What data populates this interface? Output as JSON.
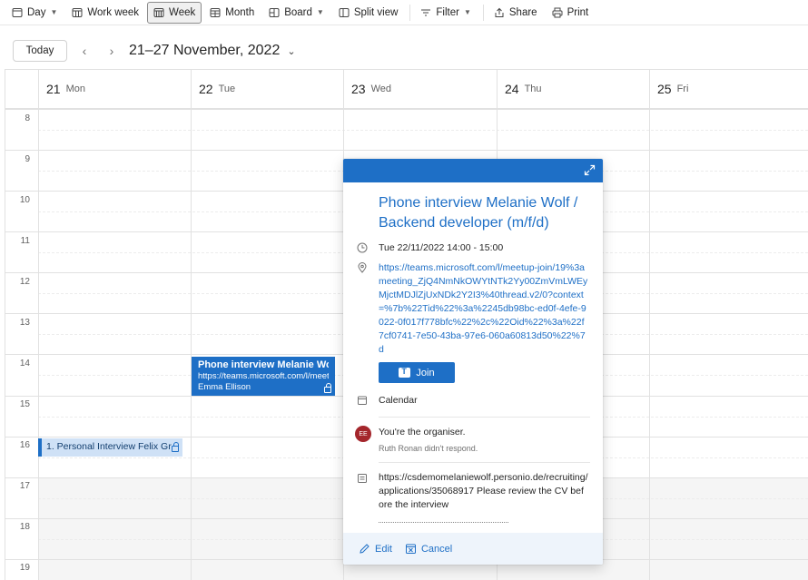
{
  "toolbar": {
    "items": [
      {
        "label": "Day",
        "icon": "day-view-icon",
        "dropdown": true
      },
      {
        "label": "Work week",
        "icon": "work-week-icon"
      },
      {
        "label": "Week",
        "icon": "week-icon",
        "active": true
      },
      {
        "label": "Month",
        "icon": "month-icon"
      },
      {
        "label": "Board",
        "icon": "board-icon",
        "dropdown": true
      },
      {
        "label": "Split view",
        "icon": "split-view-icon"
      },
      {
        "label": "Filter",
        "icon": "filter-icon",
        "dropdown": true
      },
      {
        "label": "Share",
        "icon": "share-icon"
      },
      {
        "label": "Print",
        "icon": "print-icon"
      }
    ]
  },
  "nav": {
    "today_label": "Today",
    "prev_icon": "chevron-left-icon",
    "next_icon": "chevron-right-icon",
    "range_title": "21–27 November, 2022"
  },
  "days": [
    {
      "num": "21",
      "name": "Mon"
    },
    {
      "num": "22",
      "name": "Tue"
    },
    {
      "num": "23",
      "name": "Wed"
    },
    {
      "num": "24",
      "name": "Thu"
    },
    {
      "num": "25",
      "name": "Fri"
    }
  ],
  "hours": [
    "8",
    "9",
    "10",
    "11",
    "12",
    "13",
    "14",
    "15",
    "16",
    "17",
    "18",
    "19"
  ],
  "events": {
    "main": {
      "title": "Phone interview Melanie Wolf",
      "link": "https://teams.microsoft.com/l/meetup",
      "person": "Emma Ellison"
    },
    "small": {
      "title": "1. Personal Interview Felix Gr"
    }
  },
  "popup": {
    "title": "Phone interview Melanie Wolf / Backend developer (m/f/d)",
    "datetime": "Tue 22/11/2022 14:00 - 15:00",
    "location_link": "https://teams.microsoft.com/l/meetup-join/19%3ameeting_ZjQ4NmNkOWYtNTk2Yy00ZmVmLWEyMjctMDJlZjUxNDk2Y2I3%40thread.v2/0?context=%7b%22Tid%22%3a%2245db98bc-ed0f-4efe-9022-0f017f778bfc%22%2c%22Oid%22%3a%22f7cf0741-7e50-43ba-97e6-060a60813d50%22%7d",
    "join_label": "Join",
    "calendar_label": "Calendar",
    "organiser_initials": "EE",
    "organiser_text": "You're the organiser.",
    "attendee_status": "Ruth Ronan didn't respond.",
    "notes": "https://csdemomelaniewolf.personio.de/recruiting/applications/35068917 Please review the CV before the interview",
    "edit_label": "Edit",
    "cancel_label": "Cancel"
  },
  "colors": {
    "accent": "#1e6fc6",
    "event_light": "#cfe1f6",
    "avatar": "#a4262c"
  }
}
